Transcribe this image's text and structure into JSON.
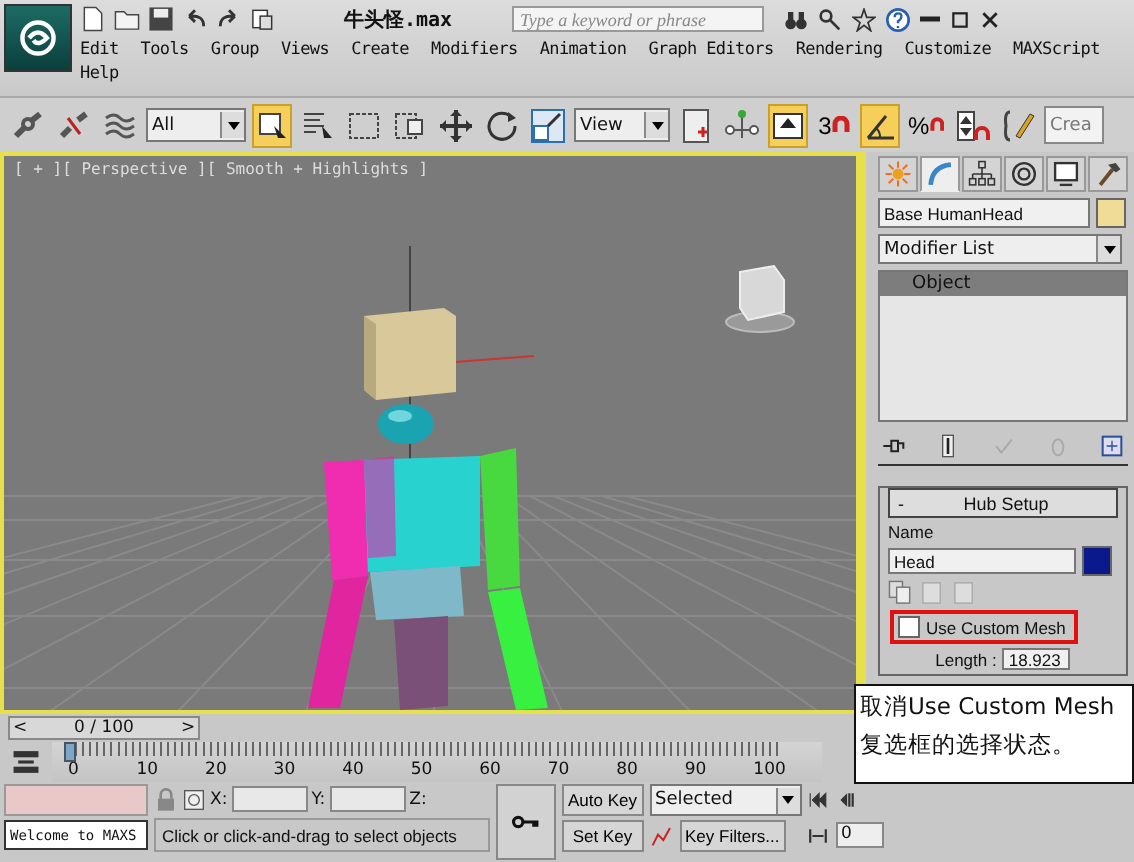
{
  "title_bar": {
    "file_title": "牛头怪.max",
    "search": {
      "placeholder": "Type a keyword or phrase"
    }
  },
  "menu": [
    "Edit",
    "Tools",
    "Group",
    "Views",
    "Create",
    "Modifiers",
    "Animation",
    "Graph Editors",
    "Rendering",
    "Customize",
    "MAXScript",
    "Help"
  ],
  "toolbar": {
    "selection_filter": "All",
    "reference_coord": "View",
    "snap_number": "3",
    "percent_snap": "%",
    "named_selection": "Crea",
    "buttons": [
      {
        "kind": "link",
        "on": false
      },
      {
        "kind": "unlink",
        "on": false
      },
      {
        "kind": "bind",
        "on": false
      },
      {
        "kind": "filter"
      },
      {
        "kind": "select",
        "on": true
      },
      {
        "kind": "select-name",
        "on": false
      },
      {
        "kind": "region",
        "on": false
      },
      {
        "kind": "window",
        "on": false
      },
      {
        "kind": "move",
        "on": false
      },
      {
        "kind": "rotate",
        "on": false
      },
      {
        "kind": "scale",
        "on": false
      },
      {
        "kind": "coord"
      },
      {
        "kind": "pivot",
        "on": false
      },
      {
        "kind": "manipulate",
        "on": false
      },
      {
        "kind": "keyboard",
        "on": true
      },
      {
        "kind": "snap",
        "on": false
      },
      {
        "kind": "angle",
        "on": true
      },
      {
        "kind": "percent",
        "on": false
      },
      {
        "kind": "spinner",
        "on": false
      },
      {
        "kind": "edit-named",
        "on": false
      },
      {
        "kind": "named"
      }
    ]
  },
  "viewport": {
    "label": "[ + ][ Perspective ][ Smooth + Highlights ]"
  },
  "command_panel": {
    "tabs": [
      {
        "kind": "create",
        "selected": false
      },
      {
        "kind": "modify",
        "selected": true
      },
      {
        "kind": "hierarchy",
        "selected": false
      },
      {
        "kind": "motion",
        "selected": false
      },
      {
        "kind": "display",
        "selected": false
      },
      {
        "kind": "utilities",
        "selected": false
      }
    ],
    "object_name": "Base HumanHead",
    "modifier_list": "Modifier List",
    "stack": [
      {
        "label": "Object",
        "selected": true
      }
    ],
    "rollout": {
      "toggle": "-",
      "title": "Hub Setup",
      "name_label": "Name",
      "name_value": "Head",
      "use_custom_mesh": {
        "label": "Use Custom Mesh",
        "checked": false
      },
      "length": {
        "label": "Length :",
        "value": "18.923"
      }
    }
  },
  "callout": {
    "lines": [
      "取消Use Custom Mesh",
      "复选框的选择状态。"
    ]
  },
  "time_slider": {
    "prev": "<",
    "position": "0 / 100",
    "next": ">",
    "level": 0
  },
  "track_bar": {
    "ticks": [
      "0",
      "10",
      "20",
      "30",
      "40",
      "50",
      "60",
      "70",
      "80",
      "90",
      "100"
    ]
  },
  "status_bar": {
    "welcome": "Welcome to MAXS",
    "x_label": "X:",
    "y_label": "Y:",
    "z_label": "Z:",
    "prompt": "Click or click-and-drag to select objects",
    "auto_key": "Auto Key",
    "set_key": "Set Key",
    "key_mode": "Selected",
    "key_filters": "Key Filters...",
    "frame": "0"
  }
}
